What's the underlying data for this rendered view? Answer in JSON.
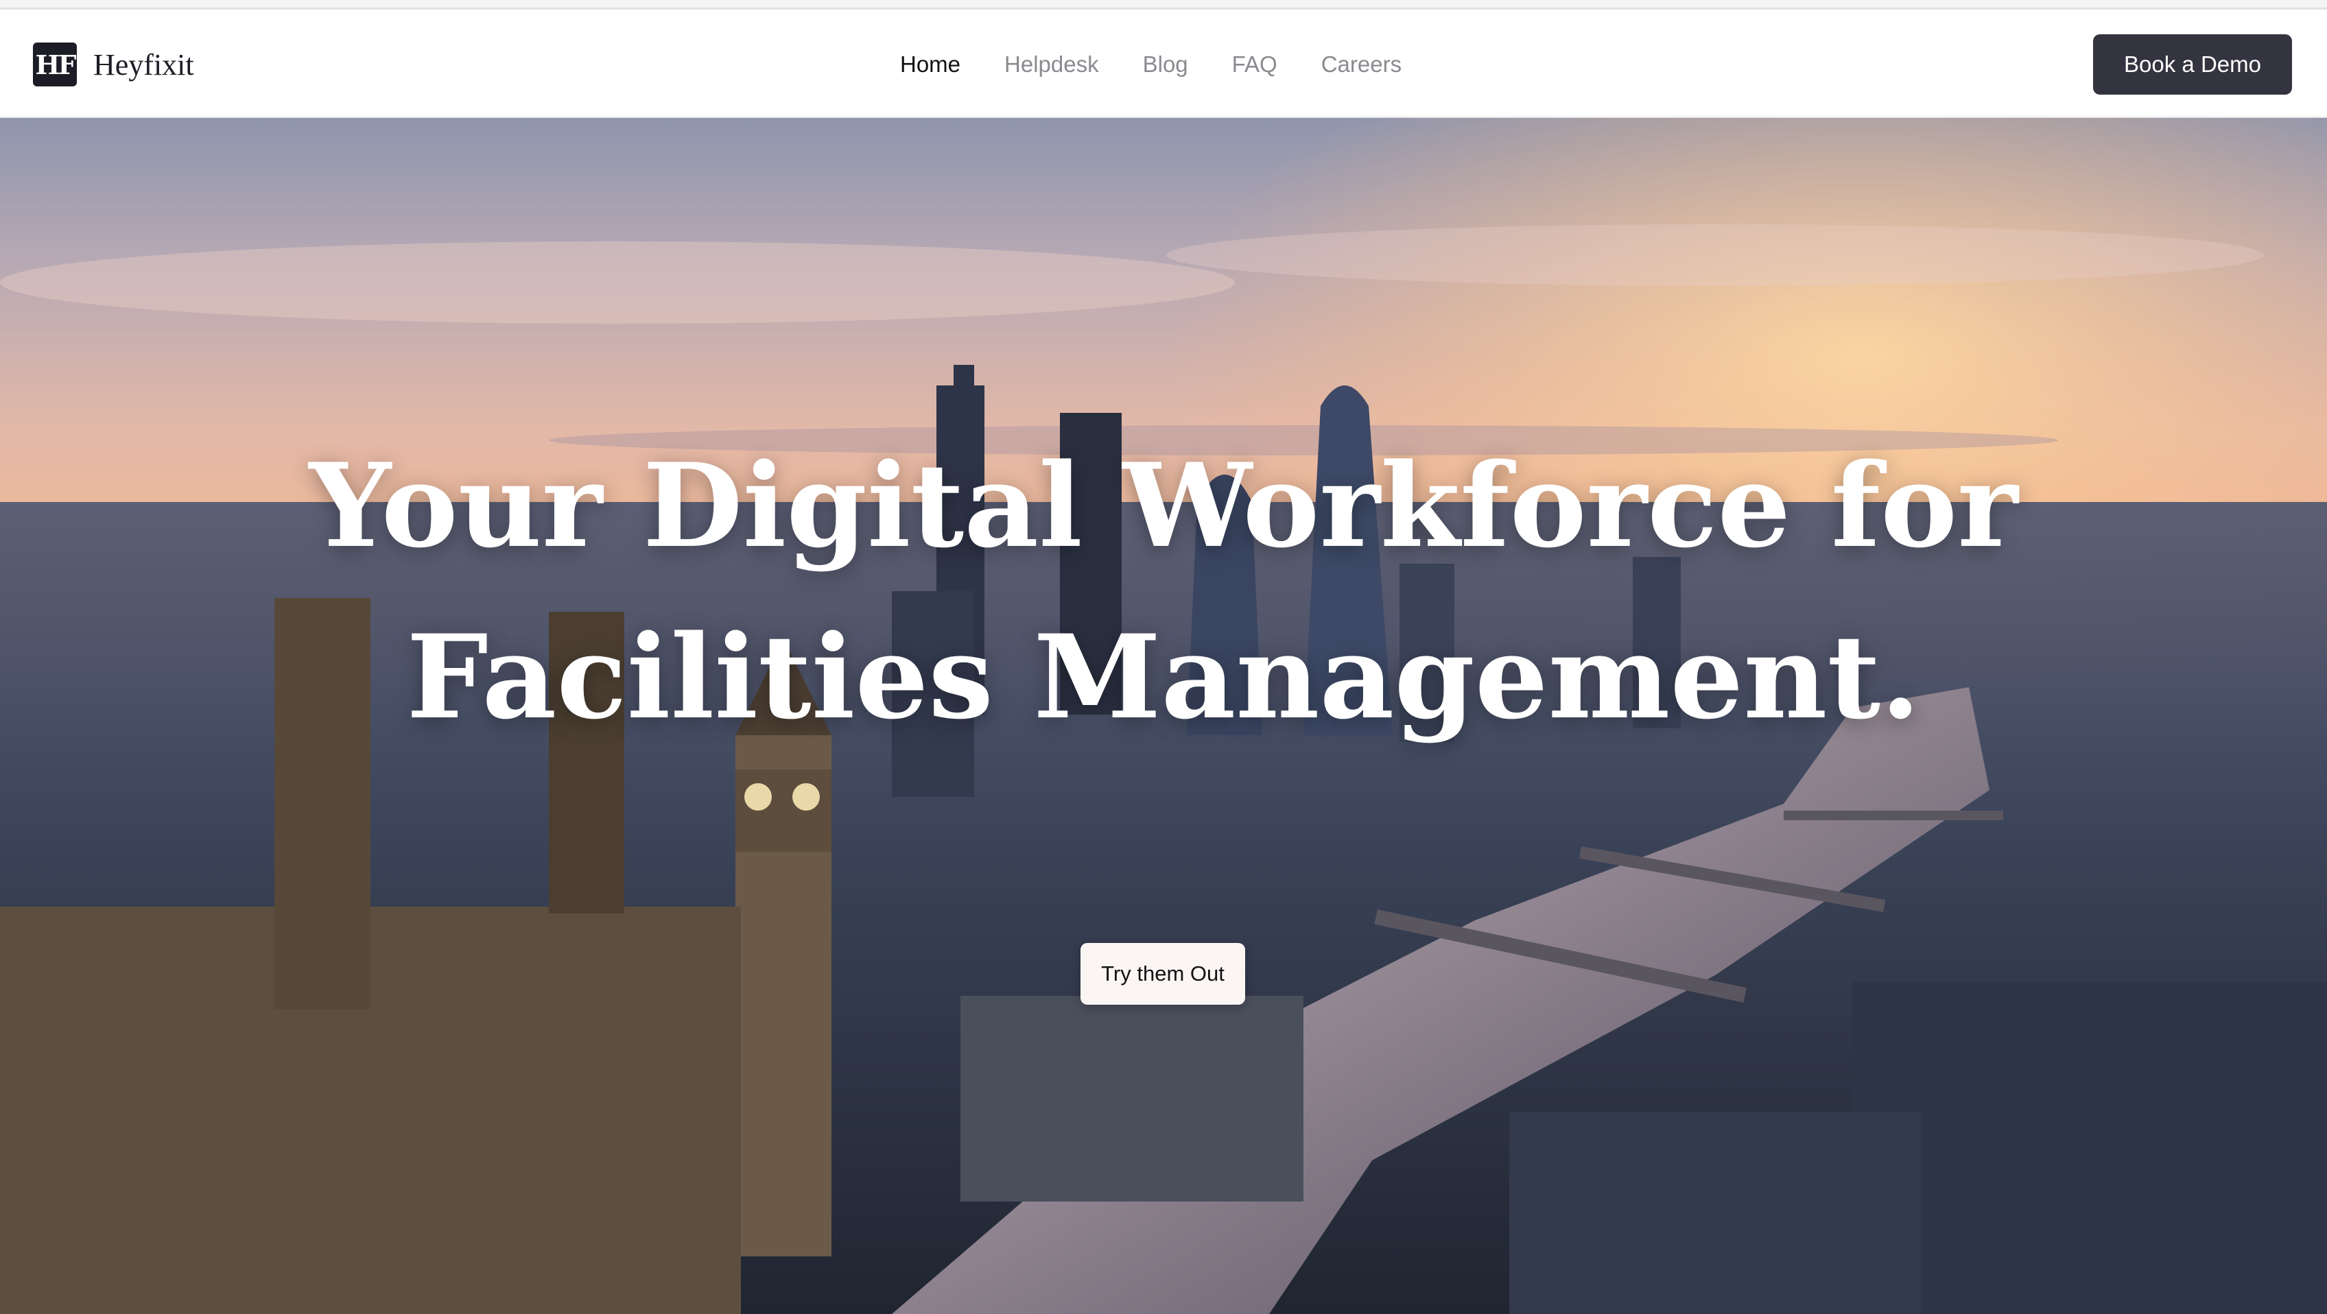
{
  "brand": {
    "logo_text": "HF",
    "name": "Heyfixit"
  },
  "nav": {
    "items": [
      {
        "label": "Home",
        "active": true
      },
      {
        "label": "Helpdesk",
        "active": false
      },
      {
        "label": "Blog",
        "active": false
      },
      {
        "label": "FAQ",
        "active": false
      },
      {
        "label": "Careers",
        "active": false
      }
    ],
    "cta_label": "Book a Demo"
  },
  "hero": {
    "headline_line1": "Your Digital Workforce for",
    "headline_line2": "Facilities Management.",
    "button_label": "Try them Out"
  },
  "colors": {
    "brand_dark": "#1c1d26",
    "cta_background": "#33343f",
    "nav_active": "#111114",
    "nav_inactive": "#8a8a90",
    "hero_button_background": "#fbf6f3"
  }
}
